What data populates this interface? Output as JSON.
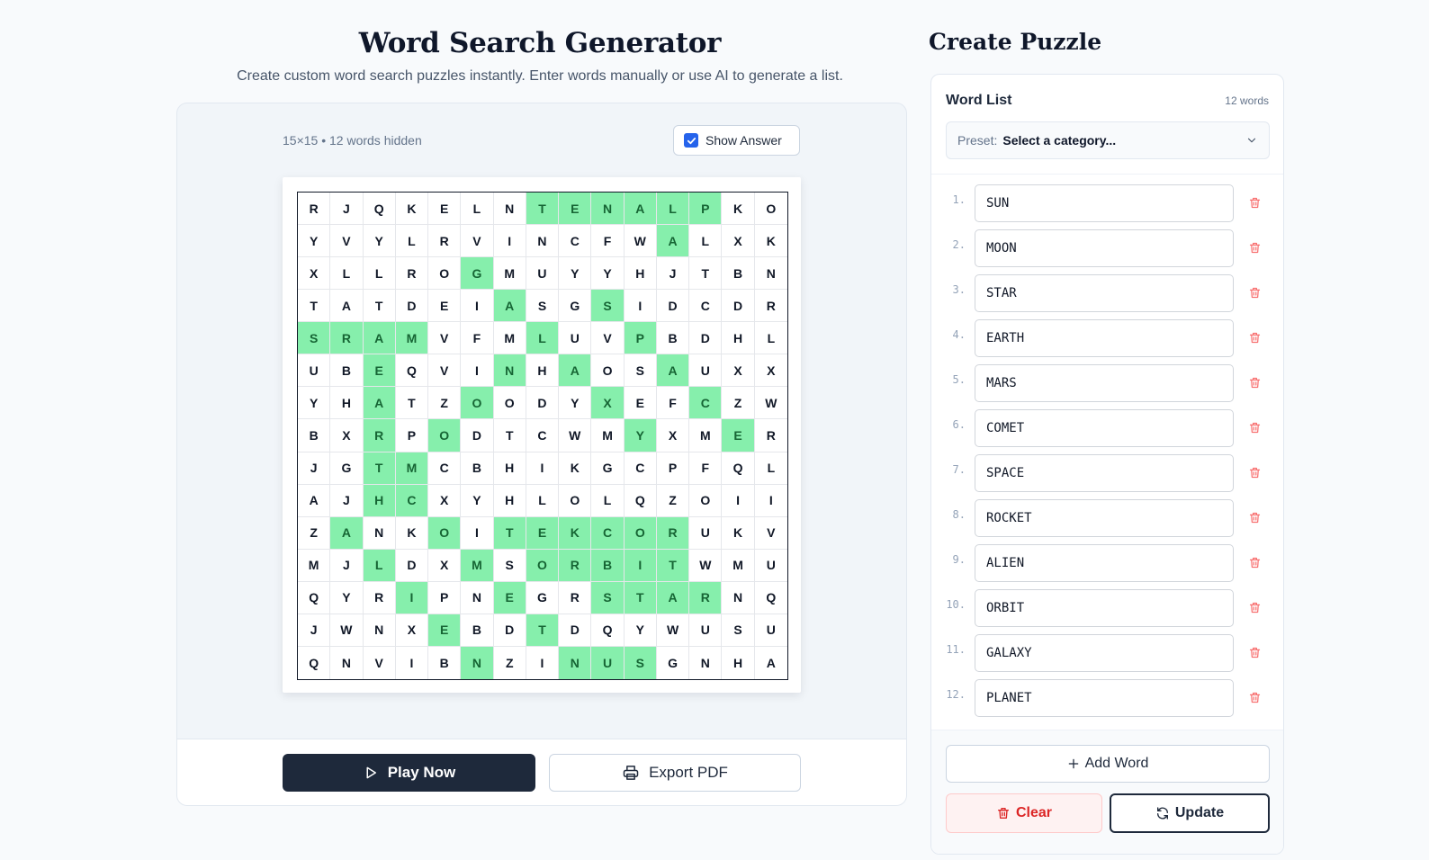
{
  "header": {
    "title": "Word Search Generator",
    "subtitle": "Create custom word search puzzles instantly. Enter words manually or use AI to generate a list."
  },
  "preview": {
    "info": "15×15 • 12 words hidden",
    "show_answer_label": "Show Answer",
    "show_answer_checked": true,
    "highlight_color": "#86efac",
    "grid": [
      "RJQKELNTENALPKO",
      "YVYLRVINCFWALXK",
      "XLLROGMUYYHJTBN",
      "TATDEIASGSIDCDR",
      "SRAMVFMLUVPBDHL",
      "UBEQVINHAOSAUXX",
      "YHATZOODYXEFCZW",
      "BXRPODTCWMYXMER",
      "JGTMCBHIKGCPFQL",
      "AJHCXYHLOLQZOII",
      "ZANKOITEKCORUKV",
      "MJLDXMSORBITWMU",
      "QYRIPNEGRSTARNQ",
      "JWNXEBDTDQYWUSU",
      "QNVIBNZINUSGNHA"
    ],
    "highlights": [
      [
        0,
        7
      ],
      [
        0,
        8
      ],
      [
        0,
        9
      ],
      [
        0,
        10
      ],
      [
        0,
        11
      ],
      [
        0,
        12
      ],
      [
        1,
        11
      ],
      [
        2,
        5
      ],
      [
        3,
        6
      ],
      [
        3,
        9
      ],
      [
        4,
        0
      ],
      [
        4,
        1
      ],
      [
        4,
        2
      ],
      [
        4,
        3
      ],
      [
        4,
        7
      ],
      [
        4,
        10
      ],
      [
        5,
        2
      ],
      [
        5,
        6
      ],
      [
        5,
        8
      ],
      [
        5,
        11
      ],
      [
        6,
        2
      ],
      [
        6,
        5
      ],
      [
        6,
        9
      ],
      [
        6,
        12
      ],
      [
        7,
        2
      ],
      [
        7,
        4
      ],
      [
        7,
        10
      ],
      [
        7,
        13
      ],
      [
        8,
        2
      ],
      [
        8,
        3
      ],
      [
        9,
        2
      ],
      [
        9,
        3
      ],
      [
        10,
        1
      ],
      [
        10,
        4
      ],
      [
        10,
        6
      ],
      [
        10,
        7
      ],
      [
        10,
        8
      ],
      [
        10,
        9
      ],
      [
        10,
        10
      ],
      [
        10,
        11
      ],
      [
        11,
        2
      ],
      [
        11,
        5
      ],
      [
        11,
        7
      ],
      [
        11,
        8
      ],
      [
        11,
        9
      ],
      [
        11,
        10
      ],
      [
        11,
        11
      ],
      [
        12,
        3
      ],
      [
        12,
        6
      ],
      [
        12,
        9
      ],
      [
        12,
        10
      ],
      [
        12,
        11
      ],
      [
        12,
        12
      ],
      [
        13,
        4
      ],
      [
        13,
        7
      ],
      [
        14,
        5
      ],
      [
        14,
        8
      ],
      [
        14,
        9
      ],
      [
        14,
        10
      ]
    ],
    "play_label": "Play Now",
    "export_label": "Export PDF"
  },
  "create": {
    "title": "Create Puzzle",
    "word_list_label": "Word List",
    "word_count": "12 words",
    "preset_label": "Preset:",
    "preset_value": "Select a category...",
    "words": [
      {
        "num": "1.",
        "value": "SUN"
      },
      {
        "num": "2.",
        "value": "MOON"
      },
      {
        "num": "3.",
        "value": "STAR"
      },
      {
        "num": "4.",
        "value": "EARTH"
      },
      {
        "num": "5.",
        "value": "MARS"
      },
      {
        "num": "6.",
        "value": "COMET"
      },
      {
        "num": "7.",
        "value": "SPACE"
      },
      {
        "num": "8.",
        "value": "ROCKET"
      },
      {
        "num": "9.",
        "value": "ALIEN"
      },
      {
        "num": "10.",
        "value": "ORBIT"
      },
      {
        "num": "11.",
        "value": "GALAXY"
      },
      {
        "num": "12.",
        "value": "PLANET"
      }
    ],
    "add_label": "Add Word",
    "clear_label": "Clear",
    "update_label": "Update"
  }
}
